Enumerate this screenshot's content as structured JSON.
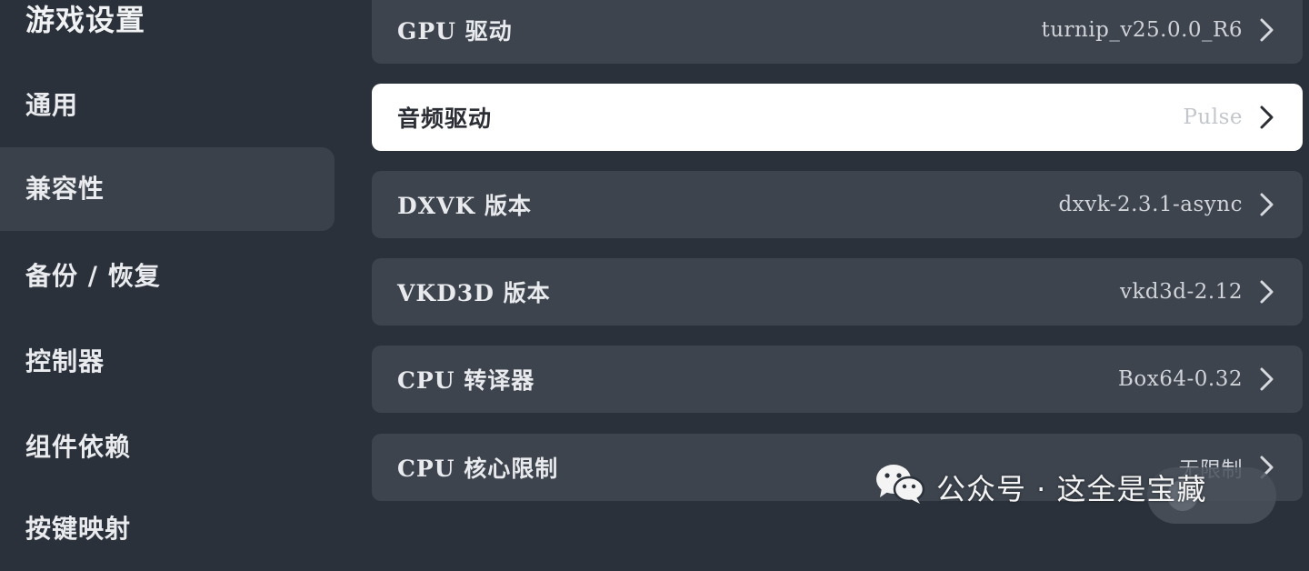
{
  "sidebar": {
    "title": "游戏设置",
    "items": [
      {
        "label": "通用"
      },
      {
        "label": "兼容性",
        "active": true
      },
      {
        "label": "备份 / 恢复"
      },
      {
        "label": "控制器"
      },
      {
        "label": "组件依赖"
      },
      {
        "label": "按键映射"
      }
    ]
  },
  "settings": [
    {
      "label": "GPU 驱动",
      "value": "turnip_v25.0.0_R6"
    },
    {
      "label": "音频驱动",
      "value": "Pulse",
      "selected": true
    },
    {
      "label": "DXVK 版本",
      "value": "dxvk-2.3.1-async"
    },
    {
      "label": "VKD3D 版本",
      "value": "vkd3d-2.12"
    },
    {
      "label": "CPU 转译器",
      "value": "Box64-0.32"
    },
    {
      "label": "CPU 核心限制",
      "value": "无限制"
    }
  ],
  "watermark": {
    "text": "公众号 · 这全是宝藏",
    "icon": "wechat-icon"
  },
  "icons": {
    "row_chevron": "chevron-right-icon"
  },
  "colors": {
    "background": "#2b313a",
    "row": "#3d444e",
    "row_selected": "#ffffff",
    "sidebar_active": "#3a414b"
  }
}
